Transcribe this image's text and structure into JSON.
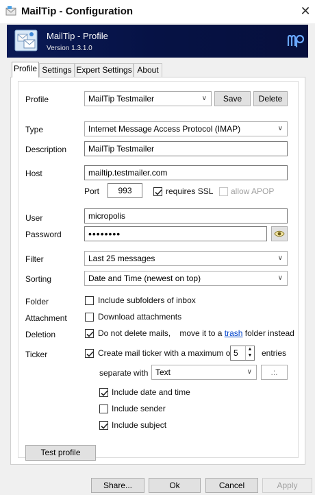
{
  "window": {
    "title": "MailTip - Configuration",
    "close_glyph": "✕"
  },
  "banner": {
    "title": "MailTip - Profile",
    "version": "Version 1.3.1.0",
    "logo_icon": "app-envelope-icon",
    "brand_icon": "mailtip-brand-icon"
  },
  "tabs": [
    {
      "label": "Profile",
      "active": true
    },
    {
      "label": "Settings",
      "active": false
    },
    {
      "label": "Expert Settings",
      "active": false
    },
    {
      "label": "About",
      "active": false
    }
  ],
  "profile": {
    "label": "Profile",
    "value": "MailTip Testmailer",
    "save_label": "Save",
    "delete_label": "Delete"
  },
  "type": {
    "label": "Type",
    "value": "Internet Message Access Protocol (IMAP)"
  },
  "description": {
    "label": "Description",
    "value": "MailTip Testmailer"
  },
  "host": {
    "label": "Host",
    "value": "mailtip.testmailer.com",
    "port_label": "Port",
    "port_value": "993",
    "ssl_label": "requires SSL",
    "ssl_checked": true,
    "apop_label": "allow APOP",
    "apop_checked": false,
    "apop_enabled": false
  },
  "user": {
    "label": "User",
    "value": "micropolis"
  },
  "password": {
    "label": "Password",
    "value": "••••••••",
    "reveal_icon": "eye-icon"
  },
  "filter": {
    "label": "Filter",
    "value": "Last 25 messages"
  },
  "sorting": {
    "label": "Sorting",
    "value": "Date and Time (newest on top)"
  },
  "folder": {
    "label": "Folder",
    "option": "Include subfolders of inbox",
    "checked": false
  },
  "attachment": {
    "label": "Attachment",
    "option": "Download attachments",
    "checked": false
  },
  "deletion": {
    "label": "Deletion",
    "option_prefix": "Do not delete mails,    move it to a",
    "link": "trash",
    "option_suffix": "folder instead",
    "checked": true
  },
  "ticker": {
    "label": "Ticker",
    "option_prefix": "Create mail ticker with a maximum of",
    "max_value": "5",
    "option_suffix": "entries",
    "checked": true,
    "separate_label": "separate with",
    "separate_value": "Text",
    "separator_value": ".:.",
    "include_date_label": "Include date and time",
    "include_date_checked": true,
    "include_sender_label": "Include sender",
    "include_sender_checked": false,
    "include_subject_label": "Include subject",
    "include_subject_checked": true
  },
  "test_profile_label": "Test profile",
  "footer": {
    "share_label": "Share...",
    "ok_label": "Ok",
    "cancel_label": "Cancel",
    "apply_label": "Apply",
    "apply_enabled": false
  },
  "colors": {
    "banner_bg": "#061245",
    "link": "#0044cc",
    "disabled_text": "#a0a0a0"
  }
}
